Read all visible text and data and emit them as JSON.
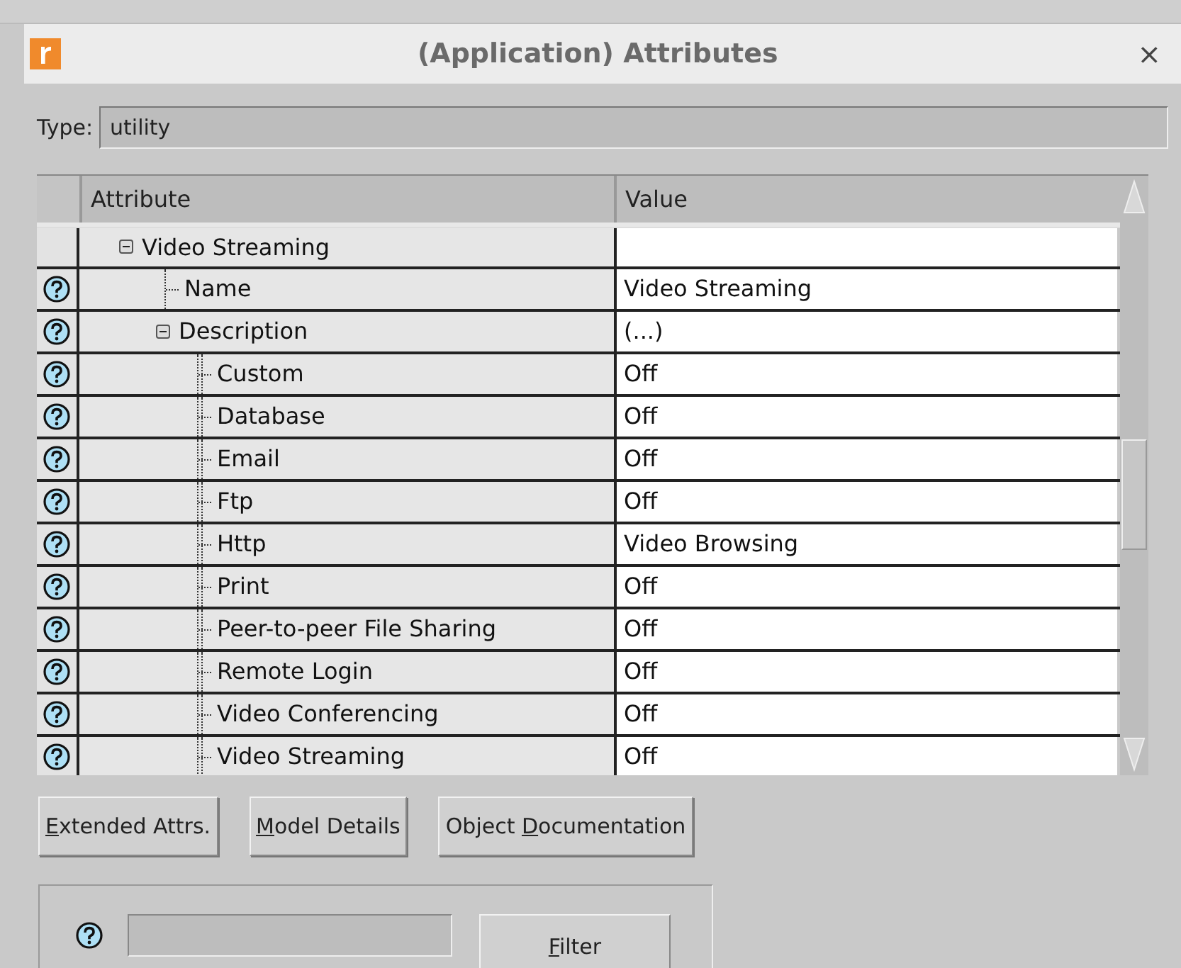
{
  "window": {
    "title": "(Application) Attributes",
    "close_glyph": "×"
  },
  "type_field": {
    "label": "Type:",
    "value": "utility"
  },
  "table": {
    "columns": [
      "Attribute",
      "Value"
    ],
    "rows": [
      {
        "label": "Video Streaming",
        "has_help": false,
        "expanded": true,
        "children": [
          {
            "label": "Name",
            "value": "Video Streaming",
            "has_help": true
          },
          {
            "label": "Description",
            "value": "(...)",
            "has_help": true,
            "expanded": true,
            "children": [
              {
                "label": "Custom",
                "value": "Off",
                "has_help": true
              },
              {
                "label": "Database",
                "value": "Off",
                "has_help": true
              },
              {
                "label": "Email",
                "value": "Off",
                "has_help": true
              },
              {
                "label": "Ftp",
                "value": "Off",
                "has_help": true
              },
              {
                "label": "Http",
                "value": "Video Browsing",
                "has_help": true
              },
              {
                "label": "Print",
                "value": "Off",
                "has_help": true
              },
              {
                "label": "Peer-to-peer File Sharing",
                "value": "Off",
                "has_help": true
              },
              {
                "label": "Remote Login",
                "value": "Off",
                "has_help": true
              },
              {
                "label": "Video Conferencing",
                "value": "Off",
                "has_help": true
              },
              {
                "label": "Video Streaming",
                "value": "Off",
                "has_help": true
              }
            ]
          }
        ]
      }
    ]
  },
  "buttons": [
    {
      "label_parts": [
        {
          "text": "E",
          "underlined": true
        },
        {
          "text": "xtended Attrs.",
          "underlined": false
        }
      ]
    },
    {
      "label_parts": [
        {
          "text": "M",
          "underlined": true
        },
        {
          "text": "odel Details",
          "underlined": false
        }
      ]
    },
    {
      "label_parts": [
        {
          "text": "Object ",
          "underlined": false
        },
        {
          "text": "D",
          "underlined": true
        },
        {
          "text": "ocumentation",
          "underlined": false
        }
      ]
    }
  ],
  "filter": {
    "button": {
      "label_parts": [
        {
          "text": "F",
          "underlined": true
        },
        {
          "text": "ilter",
          "underlined": false
        }
      ]
    }
  }
}
